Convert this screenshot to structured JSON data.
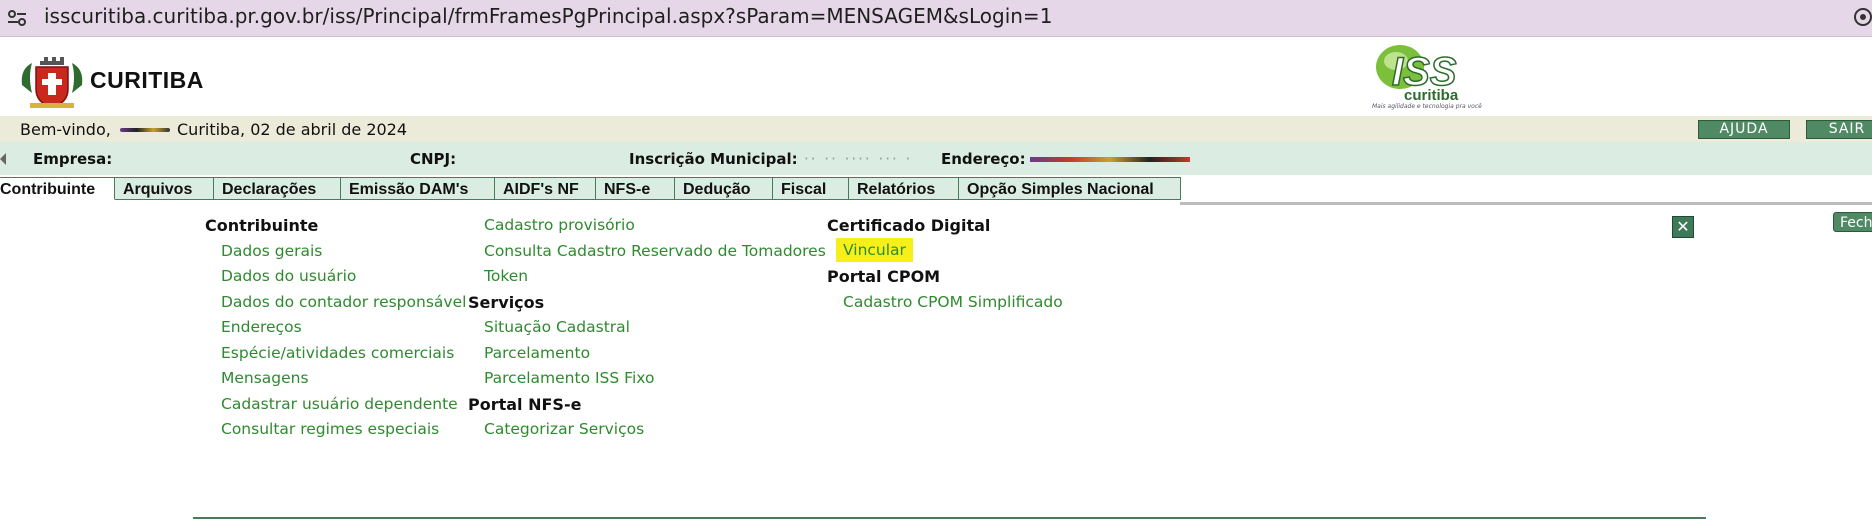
{
  "browser": {
    "url": "isscuritiba.curitiba.pr.gov.br/iss/Principal/frmFramesPgPrincipal.aspx?sParam=MENSAGEM&sLogin=1"
  },
  "header": {
    "city_name": "CURITIBA",
    "iss_logo_text": "ISS",
    "iss_logo_sub": "curitiba",
    "iss_tagline": "Mais agilidade e tecnologia pra você"
  },
  "welcome": {
    "label": "Bem-vindo,",
    "date": "Curitiba, 02 de abril de 2024",
    "help_label": "AJUDA",
    "exit_label": "SAIR"
  },
  "info": {
    "empresa_label": "Empresa:",
    "cnpj_label": "CNPJ:",
    "inscricao_label": "Inscrição Municipal:",
    "inscricao_value": "·· ·· ···· ··· ·",
    "endereco_label": "Endereço:"
  },
  "tabs": [
    {
      "label": "Contribuinte"
    },
    {
      "label": "Arquivos"
    },
    {
      "label": "Declarações"
    },
    {
      "label": "Emissão DAM's"
    },
    {
      "label": "AIDF's NF"
    },
    {
      "label": "NFS-e"
    },
    {
      "label": "Dedução"
    },
    {
      "label": "Fiscal"
    },
    {
      "label": "Relatórios"
    },
    {
      "label": "Opção Simples Nacional"
    }
  ],
  "menu": {
    "col1": {
      "heading": "Contribuinte",
      "links": [
        "Dados gerais",
        "Dados do usuário",
        "Dados do contador responsável",
        "Endereços",
        "Espécie/atividades comerciais",
        "Mensagens",
        "Cadastrar usuário dependente",
        "Consultar regimes especiais"
      ]
    },
    "col2": {
      "links_top": [
        "Cadastro provisório",
        "Consulta Cadastro Reservado de Tomadores",
        "Token"
      ],
      "heading_servicos": "Serviços",
      "links_servicos": [
        "Situação Cadastral",
        "Parcelamento",
        "Parcelamento ISS Fixo"
      ],
      "heading_nfse": "Portal NFS-e",
      "links_nfse": [
        "Categorizar Serviços"
      ]
    },
    "col3": {
      "heading_cert": "Certificado Digital",
      "link_vincular": "Vincular",
      "heading_cpom": "Portal CPOM",
      "link_cpom": "Cadastro CPOM Simplificado"
    },
    "close_symbol": "✕",
    "fechar_label": "Fechar"
  },
  "colors": {
    "link": "#2f8a2f",
    "button": "#4f8a64",
    "info_bar": "#dbede2",
    "highlight": "#f7ef1a"
  }
}
